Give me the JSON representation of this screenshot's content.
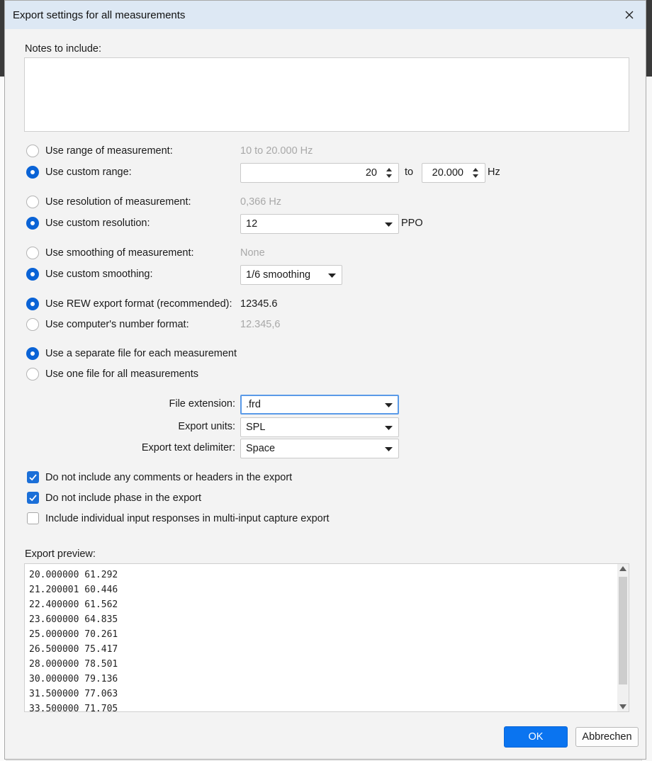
{
  "dialog": {
    "title": "Export settings for all measurements",
    "close_icon": "close-icon"
  },
  "notes": {
    "label": "Notes to include:",
    "value": ""
  },
  "range": {
    "measurement_label": "Use range of measurement:",
    "measurement_value": "10 to 20.000 Hz",
    "custom_label": "Use custom range:",
    "from": "20",
    "to_label": "to",
    "to": "20.000",
    "unit": "Hz",
    "selected": "custom"
  },
  "resolution": {
    "measurement_label": "Use resolution of measurement:",
    "measurement_value": "0,366 Hz",
    "custom_label": "Use custom resolution:",
    "custom_value": "12",
    "unit": "PPO",
    "selected": "custom"
  },
  "smoothing": {
    "measurement_label": "Use smoothing of measurement:",
    "measurement_value": "None",
    "custom_label": "Use custom smoothing:",
    "custom_value": "1/6 smoothing",
    "selected": "custom"
  },
  "number_format": {
    "rew_label": "Use REW export format (recommended):",
    "rew_example": "12345.6",
    "computer_label": "Use computer's number format:",
    "computer_example": "12.345,6",
    "selected": "rew"
  },
  "file_mode": {
    "separate_label": "Use a separate file for each measurement",
    "single_label": "Use one file for all measurements",
    "selected": "separate"
  },
  "options": {
    "extension_label": "File extension:",
    "extension_value": ".frd",
    "units_label": "Export units:",
    "units_value": "SPL",
    "delimiter_label": "Export text delimiter:",
    "delimiter_value": "Space"
  },
  "checks": {
    "no_comments_label": "Do not include any comments or headers in the export",
    "no_comments": true,
    "no_phase_label": "Do not include phase in the export",
    "no_phase": true,
    "individual_label": "Include individual input responses in multi-input capture export",
    "individual": false
  },
  "preview": {
    "label": "Export preview:",
    "lines": [
      "20.000000 61.292",
      "21.200001 60.446",
      "22.400000 61.562",
      "23.600000 64.835",
      "25.000000 70.261",
      "26.500000 75.417",
      "28.000000 78.501",
      "30.000000 79.136",
      "31.500000 77.063",
      "33.500000 71.705"
    ]
  },
  "buttons": {
    "ok": "OK",
    "cancel": "Abbrechen"
  },
  "colors": {
    "accent": "#0a63d6",
    "titlebar": "#dde8f4",
    "ok_button": "#0a74f0"
  }
}
